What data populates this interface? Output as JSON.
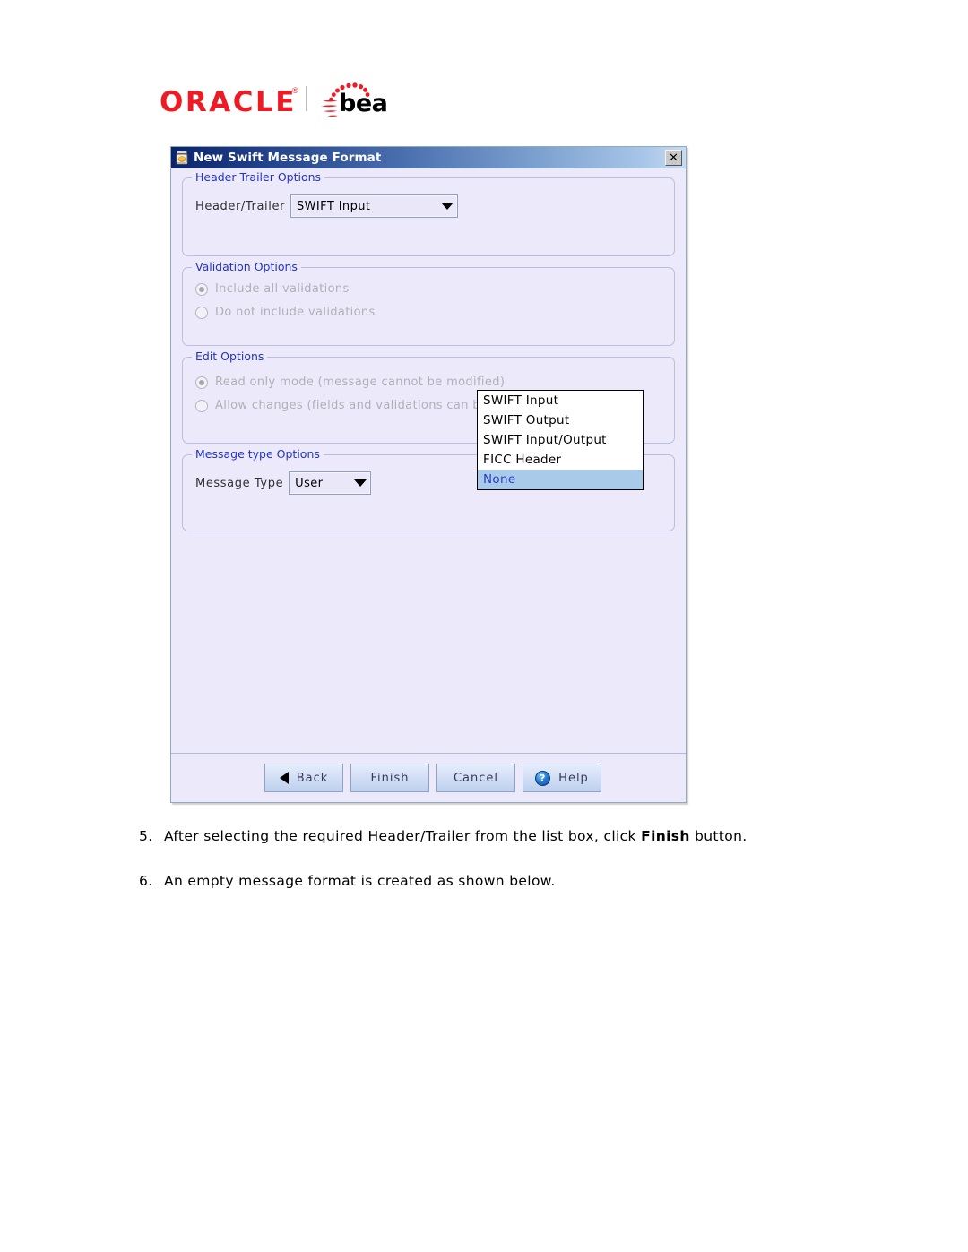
{
  "logo": {
    "oracle": "ORACLE",
    "registered": "®",
    "bea": "bea"
  },
  "dialog": {
    "title": "New Swift Message Format",
    "title_icon": "java-coffee-cup-icon",
    "close_label": "✕",
    "groups": {
      "header_trailer": {
        "title": "Header Trailer Options",
        "field_label": "Header/Trailer",
        "combo_value": "SWIFT Input",
        "options": [
          "SWIFT Input",
          "SWIFT Output",
          "SWIFT Input/Output",
          "FICC Header",
          "None"
        ],
        "highlighted_option": "None"
      },
      "validation": {
        "title": "Validation Options",
        "radios": [
          {
            "label": "Include all validations",
            "checked": true
          },
          {
            "label": "Do not include validations",
            "checked": false
          }
        ]
      },
      "edit": {
        "title": "Edit Options",
        "radios": [
          {
            "label": "Read only mode (message cannot be modified)",
            "checked": true
          },
          {
            "label": "Allow changes (fields and validations can be modified)",
            "checked": false
          }
        ]
      },
      "message_type": {
        "title": "Message type Options",
        "field_label": "Message Type",
        "combo_value": "User"
      }
    },
    "buttons": {
      "back": "Back",
      "finish": "Finish",
      "cancel": "Cancel",
      "help": "Help",
      "help_glyph": "?"
    }
  },
  "steps": [
    {
      "num": "5.",
      "pre": "After selecting the required Header/Trailer from the list box, click ",
      "bold": "Finish",
      "post": " button."
    },
    {
      "num": "6.",
      "pre": "An empty message format is created as shown below.",
      "bold": "",
      "post": ""
    }
  ],
  "colors": {
    "accent_blue": "#2233cc",
    "titlebar_dark": "#0a246a",
    "titlebar_light": "#c6dcf2",
    "highlight": "#a9cae9",
    "oracle_red": "#ed1c24",
    "dialog_bg": "#eceafa"
  }
}
